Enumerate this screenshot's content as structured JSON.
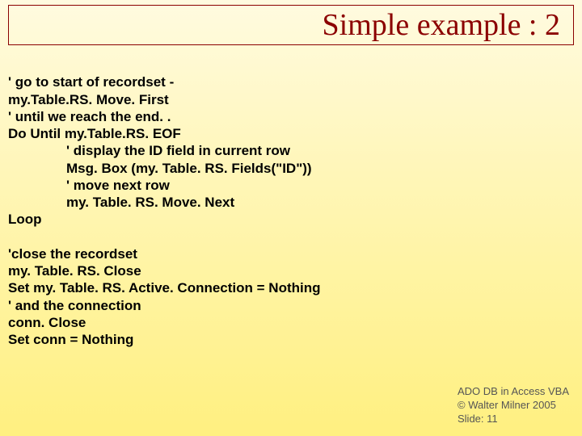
{
  "title": "Simple example : 2",
  "code": {
    "l01": "' go to start of recordset -",
    "l02": "my.Table.RS. Move. First",
    "l03": "' until we reach the end. .",
    "l04": "Do Until my.Table.RS. EOF",
    "l05": "' display the ID field in current row",
    "l06": "Msg. Box (my. Table. RS. Fields(\"ID\"))",
    "l07": "' move next row",
    "l08": "my. Table. RS. Move. Next",
    "l09": "Loop",
    "l10": "",
    "l11": "'close the recordset",
    "l12": "my. Table. RS. Close",
    "l13": "Set my. Table. RS. Active. Connection = Nothing",
    "l14": "' and the connection",
    "l15": "conn. Close",
    "l16": "Set conn = Nothing"
  },
  "footer": {
    "line1": "ADO DB in Access VBA",
    "line2": "© Walter Milner 2005",
    "line3": "Slide: 11"
  }
}
